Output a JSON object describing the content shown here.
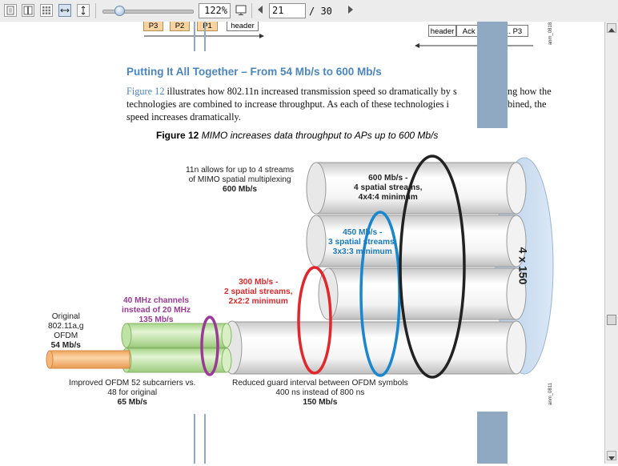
{
  "toolbar": {
    "zoom_value": "122%",
    "page_current": "21",
    "page_total": "/ 30",
    "zoom_fraction": 0.13
  },
  "document": {
    "top_boxes": [
      "P3",
      "P2",
      "P1",
      "header"
    ],
    "top_right_boxes": [
      "header",
      "Ack P1, P2, ... P3"
    ],
    "top_vert_label": "anm_0818",
    "section_heading": "Putting It All Together – From 54 Mb/s to 600 Mb/s",
    "body_lines": [
      {
        "ref": "Figure 12",
        "text": " illustrates how 802.11n increased transmission speed so dramatically by s"
      },
      {
        "ref": "",
        "text": "technologies are combined to increase throughput. As each of these technologies i"
      },
      {
        "ref": "",
        "text": "speed increases dramatically."
      }
    ],
    "body_line1_tail": "ng how the",
    "body_line2_tail": "bined, the",
    "figure_caption_bold": "Figure 12",
    "figure_caption_text": "MIMO increases data throughput to APs up to 600 Mb/s"
  },
  "figure": {
    "label_11n": [
      "11n allows for up to 4 streams",
      "of MIMO spatial multiplexing",
      "600 Mb/s"
    ],
    "label_600": [
      "600 Mb/s -",
      "4 spatial streams,",
      "4x4:4 minimum"
    ],
    "label_450": [
      "450 Mb/s -",
      "3 spatial streams,",
      "3x3:3 minimum"
    ],
    "label_300": [
      "300 Mb/s -",
      "2 spatial streams,",
      "2x2:2 minimum"
    ],
    "label_40mhz": [
      "40 MHz channels",
      "instead of 20 MHz",
      "135 Mb/s"
    ],
    "label_original": [
      "Original",
      "802.11a,g",
      "OFDM",
      "54 Mb/s"
    ],
    "label_ofdm52": [
      "Improved OFDM 52 subcarriers vs.",
      "48 for original",
      "65 Mb/s"
    ],
    "label_guard": [
      "Reduced guard interval between OFDM symbols",
      "400 ns instead of 800 ns",
      "150 Mb/s"
    ],
    "label_4x150": "4 x 150",
    "vert_label": "anm_0811",
    "colors": {
      "heading": "#4b86c0",
      "label_450": "#1a79c0",
      "label_300": "#e0282c",
      "label_40mhz": "#9b3a96",
      "pipe_orange": "#f6b676",
      "pipe_green": "#c3e6a7",
      "ring_purple": "#9b3a96",
      "ring_red": "#e0282c",
      "ring_blue": "#1a86cd",
      "ring_black": "#222222",
      "disk_blue": "#c6daf0"
    }
  }
}
